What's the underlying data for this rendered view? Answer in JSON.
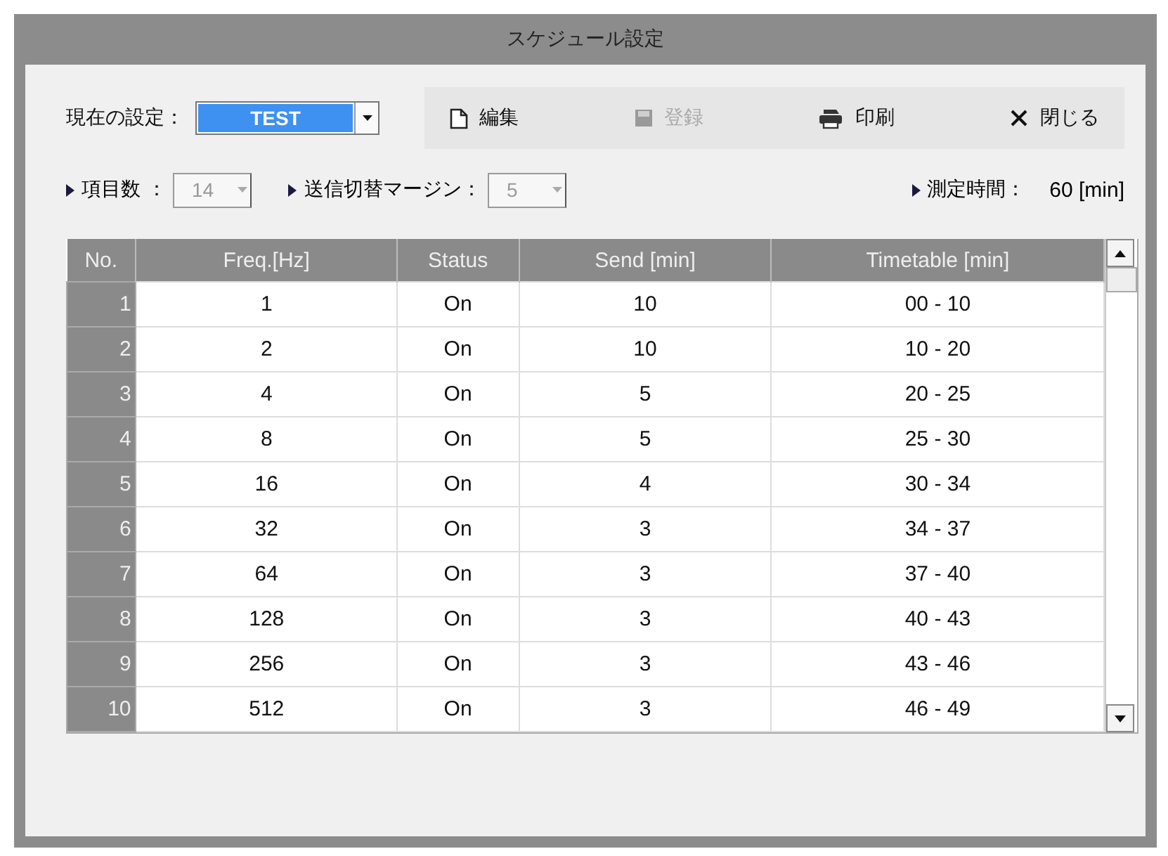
{
  "window": {
    "title": "スケジュール設定"
  },
  "current_setting": {
    "label": "現在の設定：",
    "value": "TEST"
  },
  "toolbar": [
    {
      "kind": "edit",
      "label": "編集",
      "disabled": false
    },
    {
      "kind": "save",
      "label": "登録",
      "disabled": true
    },
    {
      "kind": "print",
      "label": "印刷",
      "disabled": false
    },
    {
      "kind": "close",
      "label": "閉じる",
      "disabled": false
    }
  ],
  "settings": [
    {
      "kind": "combo",
      "label": "項目数 ：",
      "value": "14",
      "disabled": true
    },
    {
      "kind": "combo",
      "label": "送信切替マージン：",
      "value": "5",
      "disabled": true
    },
    {
      "kind": "reading",
      "label": "測定時間：",
      "value": "60 [min]"
    }
  ],
  "table": {
    "columns": [
      "No.",
      "Freq.[Hz]",
      "Status",
      "Send [min]",
      "Timetable [min]"
    ],
    "rows": [
      [
        "1",
        "1",
        "On",
        "10",
        "00 - 10"
      ],
      [
        "2",
        "2",
        "On",
        "10",
        "10 - 20"
      ],
      [
        "3",
        "4",
        "On",
        "5",
        "20 - 25"
      ],
      [
        "4",
        "8",
        "On",
        "5",
        "25 - 30"
      ],
      [
        "5",
        "16",
        "On",
        "4",
        "30 - 34"
      ],
      [
        "6",
        "32",
        "On",
        "3",
        "34 - 37"
      ],
      [
        "7",
        "64",
        "On",
        "3",
        "37 - 40"
      ],
      [
        "8",
        "128",
        "On",
        "3",
        "40 - 43"
      ],
      [
        "9",
        "256",
        "On",
        "3",
        "43 - 46"
      ],
      [
        "10",
        "512",
        "On",
        "3",
        "46 - 49"
      ]
    ]
  }
}
